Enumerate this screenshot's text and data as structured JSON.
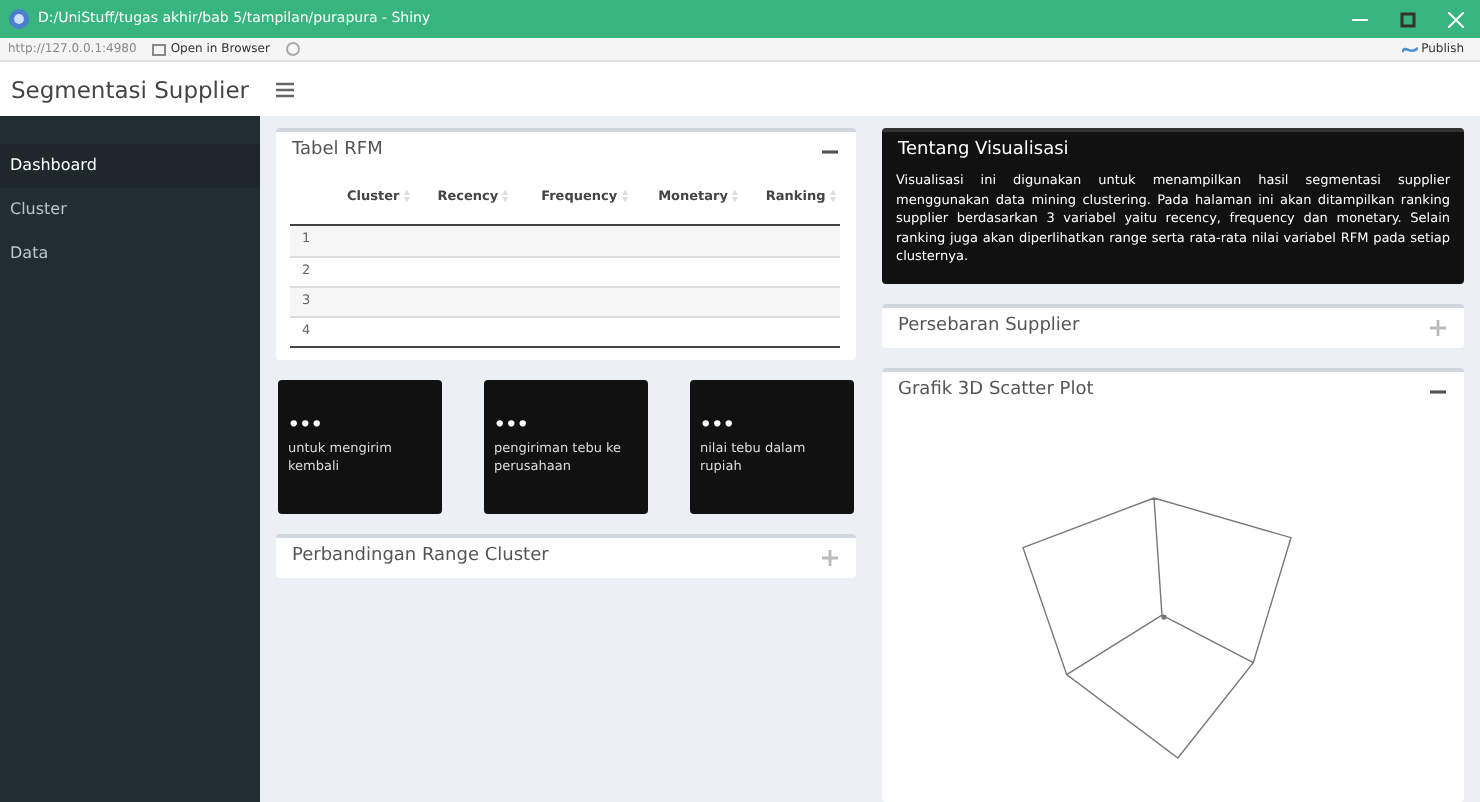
{
  "window": {
    "title": "D:/UniStuff/tugas akhir/bab 5/tampilan/purapura - Shiny"
  },
  "toolbar": {
    "url": "http://127.0.0.1:4980",
    "open_button": "Open in Browser",
    "publish_button": "Publish"
  },
  "header": {
    "brand": "Segmentasi Supplier"
  },
  "sidebar": {
    "items": [
      {
        "label": "Dashboard",
        "selected": true
      },
      {
        "label": "Cluster",
        "selected": false
      },
      {
        "label": "Data",
        "selected": false
      }
    ]
  },
  "rfm_box": {
    "title": "Tabel RFM",
    "collapsed": false,
    "columns": [
      "Cluster",
      "Recency",
      "Frequency",
      "Monetary",
      "Ranking"
    ],
    "rows": [
      "1",
      "2",
      "3",
      "4"
    ]
  },
  "info_boxes": [
    {
      "value": "•••",
      "text": "untuk mengirim kembali"
    },
    {
      "value": "•••",
      "text": "pengiriman tebu ke perusahaan"
    },
    {
      "value": "•••",
      "text": "nilai tebu dalam rupiah"
    }
  ],
  "range_box": {
    "title": "Perbandingan Range Cluster",
    "collapsed": true
  },
  "about_box": {
    "title": "Tentang Visualisasi",
    "text": "Visualisasi ini digunakan untuk menampilkan hasil segmentasi supplier menggunakan data mining clustering. Pada halaman ini akan ditampilkan ranking supplier berdasarkan 3 variabel yaitu recency, frequency dan monetary. Selain ranking juga akan diperlihatkan range serta rata-rata nilai variabel RFM pada setiap clusternya."
  },
  "spread_box": {
    "title": "Persebaran Supplier",
    "collapsed": true
  },
  "scatter_box": {
    "title": "Grafik 3D Scatter Plot",
    "collapsed": false
  }
}
